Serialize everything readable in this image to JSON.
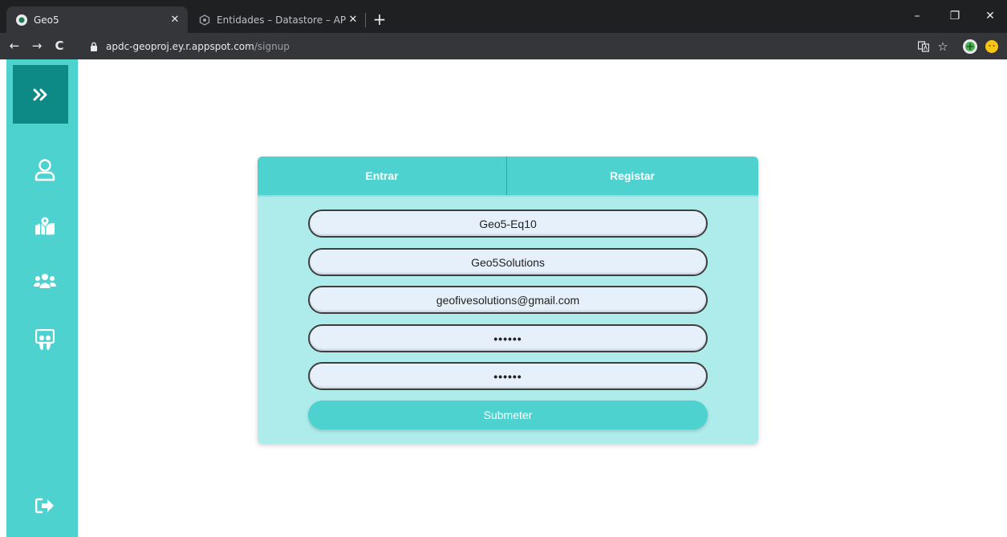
{
  "browser": {
    "tabs": [
      {
        "title": "Geo5",
        "close": "✕"
      },
      {
        "title": "Entidades – Datastore – APDC- G",
        "close": "✕"
      }
    ],
    "new_tab": "+",
    "window_controls": {
      "minimize": "–",
      "restore": "❐",
      "close": "✕"
    },
    "url_host": "apdc-geoproj.ey.r.appspot.com",
    "url_path": "/signup",
    "nav": {
      "back": "←",
      "forward": "→",
      "reload": "C"
    },
    "star": "☆"
  },
  "sidebar": {
    "expand_glyph": "»",
    "items": [
      {
        "icon": "user-icon"
      },
      {
        "icon": "map-marker-icon"
      },
      {
        "icon": "users-icon"
      },
      {
        "icon": "slideshare-icon"
      }
    ],
    "logout_icon": "sign-out-icon"
  },
  "form": {
    "tabs": {
      "login": "Entrar",
      "register": "Registar"
    },
    "fields": {
      "username": "Geo5-Eq10",
      "name": "Geo5Solutions",
      "email": "geofivesolutions@gmail.com",
      "password": "••••••",
      "confirm_password": "••••••"
    },
    "submit_label": "Submeter"
  },
  "colors": {
    "sidebar": "#4dd2cf",
    "sidebar_active": "#0e8a86",
    "card": "#aeecec",
    "accent": "#4dd2cf",
    "field_bg": "#e6f0fb"
  }
}
